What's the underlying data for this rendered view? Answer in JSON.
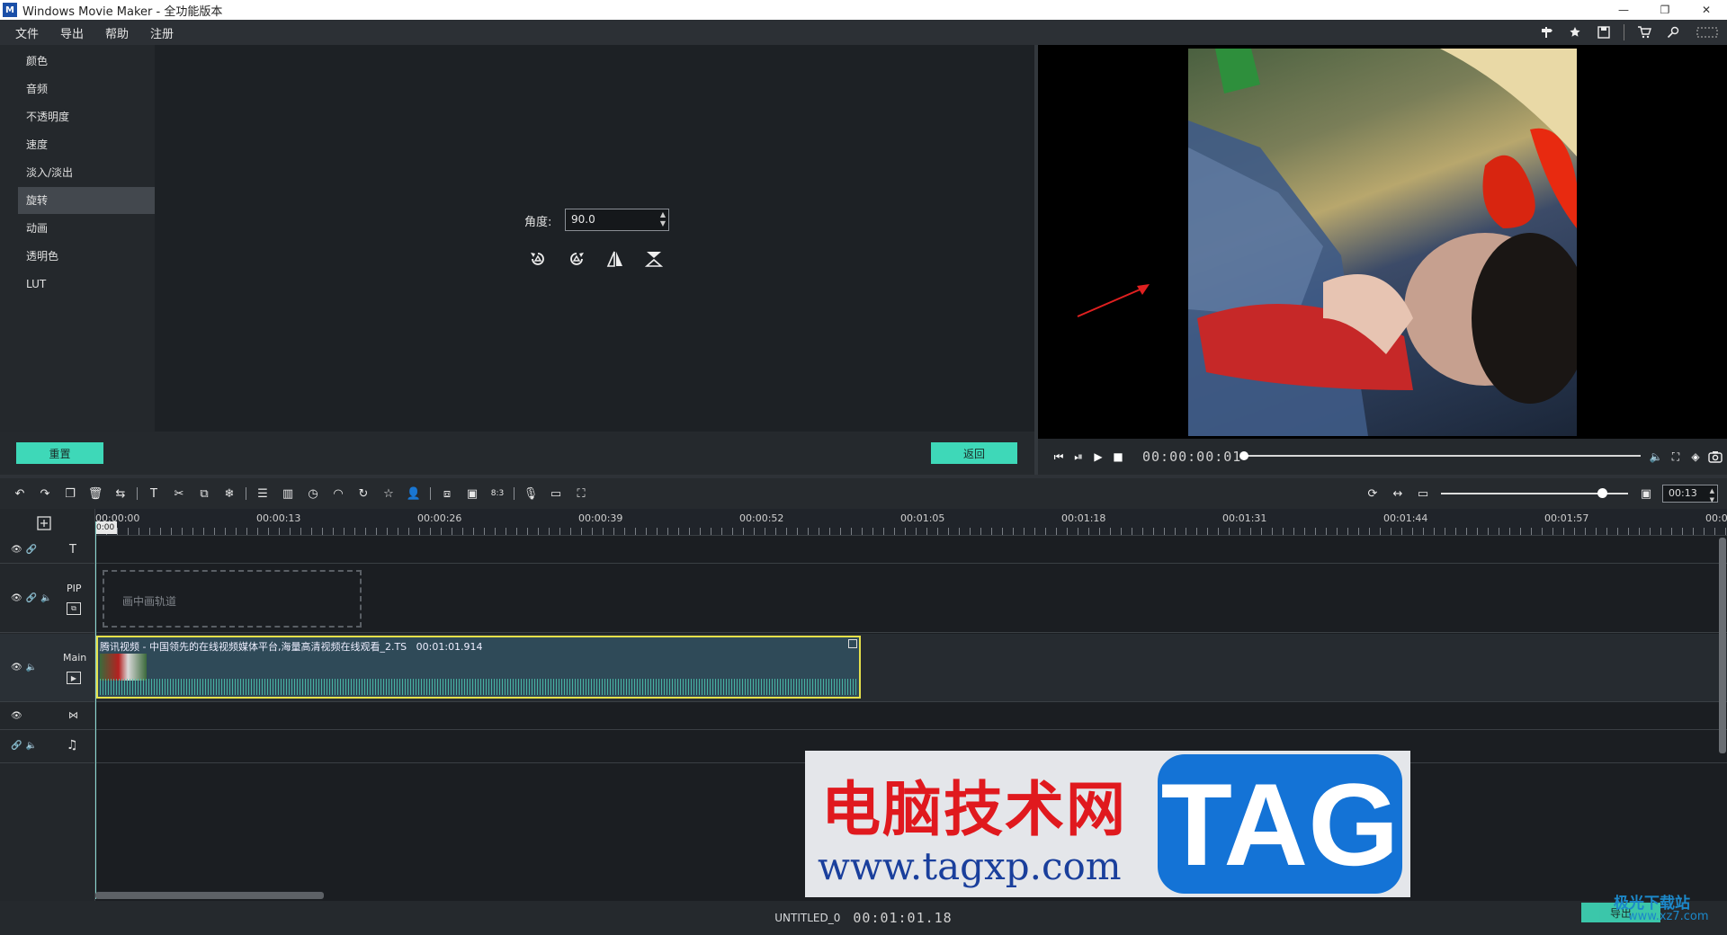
{
  "app": {
    "logo_text": "M",
    "title": "Windows Movie Maker  - 全功能版本",
    "controls": [
      "—",
      "❐",
      "✕"
    ]
  },
  "menu": {
    "items": [
      "文件",
      "导出",
      "帮助",
      "注册"
    ]
  },
  "sidebar": {
    "items": [
      {
        "label": "颜色",
        "active": false
      },
      {
        "label": "音频",
        "active": false
      },
      {
        "label": "不透明度",
        "active": false
      },
      {
        "label": "速度",
        "active": false
      },
      {
        "label": "淡入/淡出",
        "active": false
      },
      {
        "label": "旋转",
        "active": true
      },
      {
        "label": "动画",
        "active": false
      },
      {
        "label": "透明色",
        "active": false
      },
      {
        "label": "LUT",
        "active": false
      }
    ]
  },
  "rotate_panel": {
    "angle_label": "角度:",
    "angle_value": "90.0",
    "reset_button": "重置",
    "back_button": "返回"
  },
  "player": {
    "timecode": "00:00:00:01",
    "seek_position": 0.0
  },
  "toolbar": {
    "zoom_value": "00:13",
    "zoom_level": 0.86
  },
  "timeline": {
    "ruler_labels": [
      "00:00:00",
      "00:00:13",
      "00:00:26",
      "00:00:39",
      "00:00:52",
      "00:01:05",
      "00:01:18",
      "00:01:31",
      "00:01:44",
      "00:01:57",
      "00:0"
    ],
    "playhead_label": "0:00",
    "tracks": {
      "text_label": "T",
      "pip_label": "PIP",
      "pip_placeholder": "画中画轨道",
      "main_label": "Main"
    },
    "clip": {
      "title": "腾讯视频 - 中国领先的在线视频媒体平台,海量高清视频在线观看_2.TS",
      "duration": "00:01:01.914"
    }
  },
  "status": {
    "project_name": "UNTITLED_0",
    "total_time": "00:01:01.18"
  },
  "watermark": {
    "cn_text": "电脑技术网",
    "url_text": "www.tagxp.com",
    "tag_text": "TAG",
    "corner_text": "极光下载站",
    "corner_url": "www.xz7.com",
    "corner_button": "导出"
  },
  "colors": {
    "accent_green": "#3ed8b8",
    "clip_border": "#e5e04a",
    "arrow": "#e02020"
  }
}
